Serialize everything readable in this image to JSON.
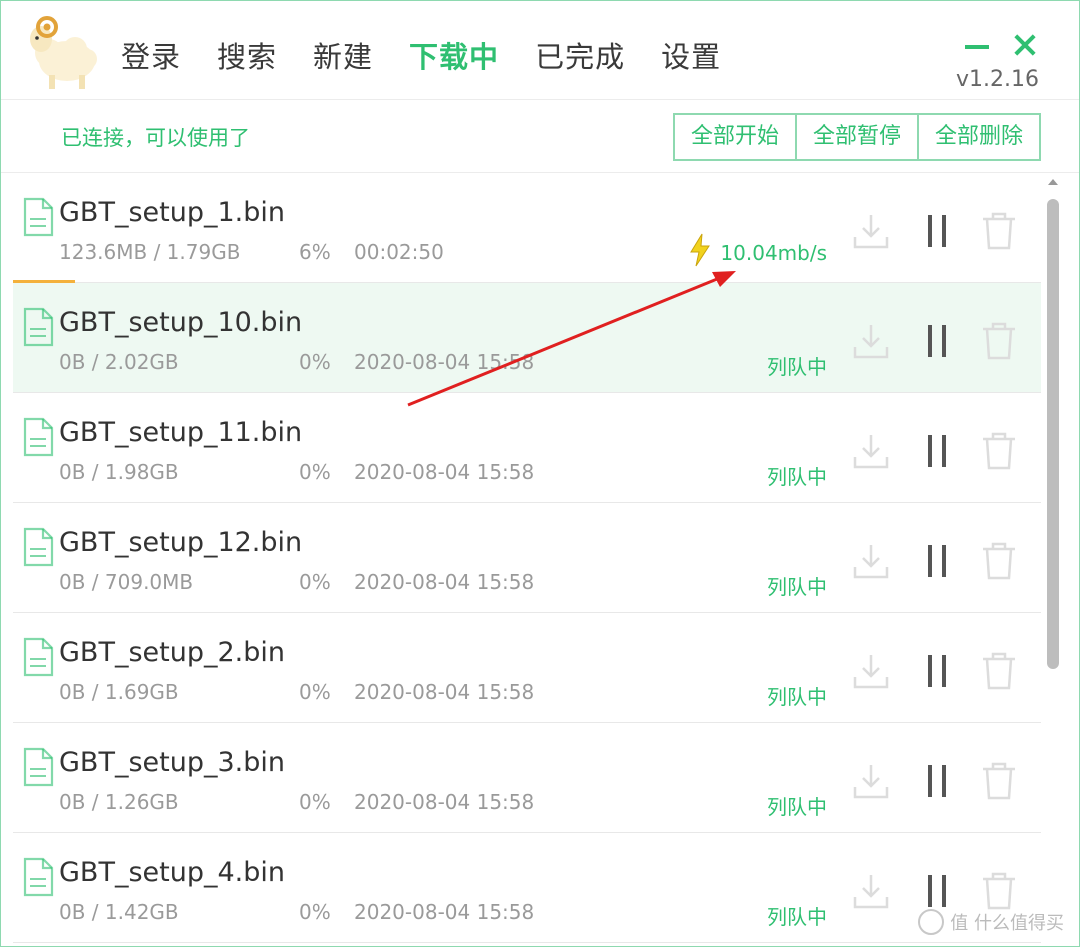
{
  "header": {
    "nav": [
      "登录",
      "搜索",
      "新建",
      "下载中",
      "已完成",
      "设置"
    ],
    "active_tab": "下载中",
    "version": "v1.2.16"
  },
  "toolbar": {
    "status": "已连接，可以使用了",
    "start_all": "全部开始",
    "pause_all": "全部暂停",
    "delete_all": "全部删除"
  },
  "downloads": [
    {
      "name": "GBT_setup_1.bin",
      "size": "123.6MB / 1.79GB",
      "percent": "6%",
      "time": "00:02:50",
      "status": "10.04mb/s",
      "progress": 0.06
    },
    {
      "name": "GBT_setup_10.bin",
      "size": "0B / 2.02GB",
      "percent": "0%",
      "time": "2020-08-04 15:58",
      "status": "列队中"
    },
    {
      "name": "GBT_setup_11.bin",
      "size": "0B / 1.98GB",
      "percent": "0%",
      "time": "2020-08-04 15:58",
      "status": "列队中"
    },
    {
      "name": "GBT_setup_12.bin",
      "size": "0B / 709.0MB",
      "percent": "0%",
      "time": "2020-08-04 15:58",
      "status": "列队中"
    },
    {
      "name": "GBT_setup_2.bin",
      "size": "0B / 1.69GB",
      "percent": "0%",
      "time": "2020-08-04 15:58",
      "status": "列队中"
    },
    {
      "name": "GBT_setup_3.bin",
      "size": "0B / 1.26GB",
      "percent": "0%",
      "time": "2020-08-04 15:58",
      "status": "列队中"
    },
    {
      "name": "GBT_setup_4.bin",
      "size": "0B / 1.42GB",
      "percent": "0%",
      "time": "2020-08-04 15:58",
      "status": "列队中"
    }
  ],
  "watermark": "值 什么值得买",
  "colors": {
    "accent": "#2fbf71",
    "progress": "#f4b13c",
    "annotation": "#e02020"
  }
}
